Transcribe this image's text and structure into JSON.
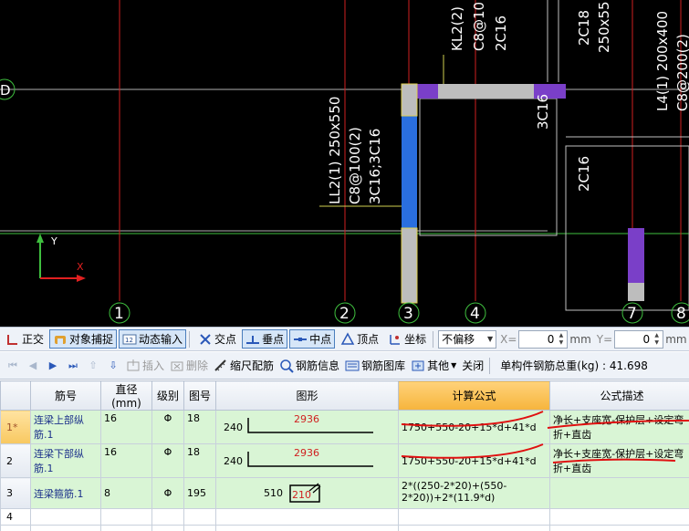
{
  "cad": {
    "axis_labels": [
      "D",
      "1",
      "2",
      "3",
      "4",
      "7",
      "8"
    ],
    "beams": [
      {
        "name": "LL2(1) 250x550",
        "stirrup": "C8@100(2)",
        "bars": "3C16;3C16"
      },
      {
        "name": "KL2(2)",
        "stirrup": "C8@10",
        "bars": "2C16"
      },
      {
        "name": "2C18",
        "extra": "250x55"
      },
      {
        "name": "L4(1) 200x400",
        "stirrup": "C8@200(2)"
      },
      {
        "name": "3C16"
      },
      {
        "name": "2C16"
      }
    ],
    "axis_text": {
      "y": "Y",
      "x": "X"
    }
  },
  "snapbar": {
    "ortho": "正交",
    "snap": "对象捕捉",
    "dynamic": "动态输入",
    "intersection": "交点",
    "perpendicular": "垂点",
    "midpoint": "中点",
    "vertex": "顶点",
    "coordinate": "坐标",
    "offset": "不偏移",
    "x_label": "X=",
    "x_value": "0",
    "y_label": "Y=",
    "y_value": "0",
    "unit": "mm"
  },
  "rebarbar": {
    "insert": "插入",
    "delete": "删除",
    "scale": "缩尺配筋",
    "info": "钢筋信息",
    "library": "钢筋图库",
    "other": "其他",
    "close": "关闭",
    "weight": "单构件钢筋总重(kg) : 41.698"
  },
  "table": {
    "headers": [
      "",
      "筋号",
      "直径(mm)",
      "级别",
      "图号",
      "图形",
      "计算公式",
      "公式描述"
    ],
    "rows": [
      {
        "num": "1*",
        "name": "连梁上部纵筋.1",
        "dia": "16",
        "grade": "Φ",
        "fig": "18",
        "left": "240",
        "len": "2936",
        "formula": "1750+550-20+15*d+41*d",
        "desc": "净长+支座宽-保护层+设定弯折+直齿"
      },
      {
        "num": "2",
        "name": "连梁下部纵筋.1",
        "dia": "16",
        "grade": "Φ",
        "fig": "18",
        "left": "240",
        "len": "2936",
        "formula": "1750+550-20+15*d+41*d",
        "desc": "净长+支座宽-保护层+设定弯折+直齿"
      },
      {
        "num": "3",
        "name": "连梁箍筋.1",
        "dia": "8",
        "grade": "Φ",
        "fig": "195",
        "left": "510",
        "len": "210",
        "formula": "2*((250-2*20)+(550-2*20))+2*(11.9*d)",
        "desc": ""
      },
      {
        "num": "4",
        "name": "",
        "dia": "",
        "grade": "",
        "fig": "",
        "left": "",
        "len": "",
        "formula": "",
        "desc": ""
      }
    ]
  }
}
